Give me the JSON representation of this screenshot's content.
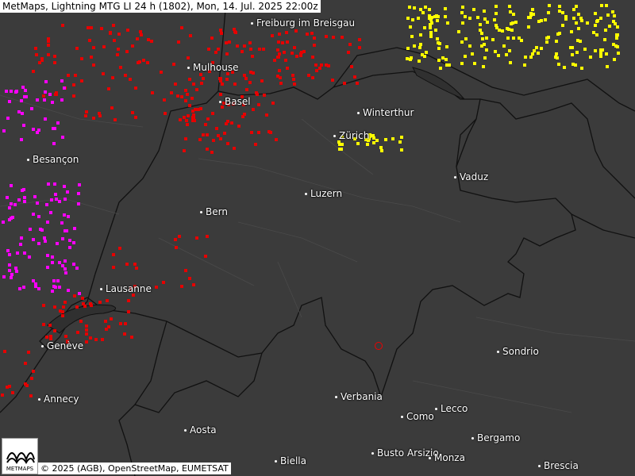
{
  "title": "MetMaps, Lightning MTG LI 24 h (1802), Mon, 14. Jul. 2025 22:00z",
  "credit": "© 2025 (AGB), OpenStreetMap, EUMETSAT",
  "logo_text": "METMAPS",
  "colors": {
    "background": "#3b3b3b",
    "border": "#111111",
    "old": "#e60000",
    "mid": "#ff00ff",
    "new": "#ffff00",
    "orange": "#ff8c00"
  },
  "cities": [
    {
      "name": "Freiburg im Breisgau"
    },
    {
      "name": "Mulhouse"
    },
    {
      "name": "Basel"
    },
    {
      "name": "Winterthur"
    },
    {
      "name": "Zürich"
    },
    {
      "name": "Besançon"
    },
    {
      "name": "Vaduz"
    },
    {
      "name": "Luzern"
    },
    {
      "name": "Bern"
    },
    {
      "name": "Lausanne"
    },
    {
      "name": "Genève"
    },
    {
      "name": "Annecy"
    },
    {
      "name": "Sondrio"
    },
    {
      "name": "Verbania"
    },
    {
      "name": "Como"
    },
    {
      "name": "Lecco"
    },
    {
      "name": "Aosta"
    },
    {
      "name": "Bergamo"
    },
    {
      "name": "Busto Arsizio"
    },
    {
      "name": "Monza"
    },
    {
      "name": "Biella"
    },
    {
      "name": "Brescia"
    }
  ]
}
